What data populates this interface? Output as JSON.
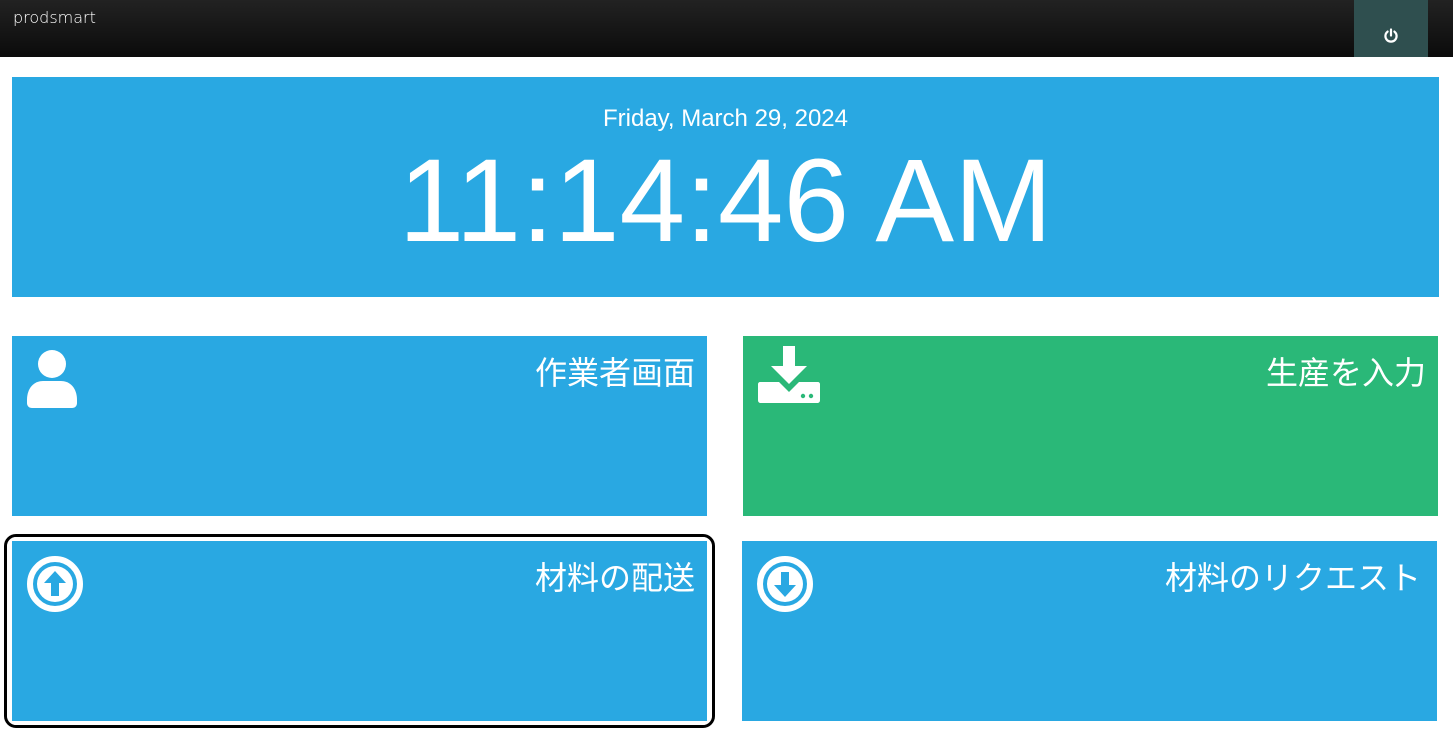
{
  "navbar": {
    "brand": "prodsmart",
    "power_icon": "power-icon"
  },
  "clock": {
    "date": "Friday, March 29, 2024",
    "time": "11:14:46 AM"
  },
  "tiles": [
    {
      "label": "作業者画面",
      "icon": "user-icon",
      "color": "#29a8e2"
    },
    {
      "label": "生産を入力",
      "icon": "download-icon",
      "color": "#2ab878"
    },
    {
      "label": "材料の配送",
      "icon": "arrow-up-circle-icon",
      "color": "#29a8e2"
    },
    {
      "label": "材料のリクエスト",
      "icon": "arrow-down-circle-icon",
      "color": "#29a8e2"
    }
  ],
  "colors": {
    "primary": "#29a8e2",
    "success": "#2ab878",
    "navbar": "#111111",
    "power_button": "#2f4f4f"
  }
}
